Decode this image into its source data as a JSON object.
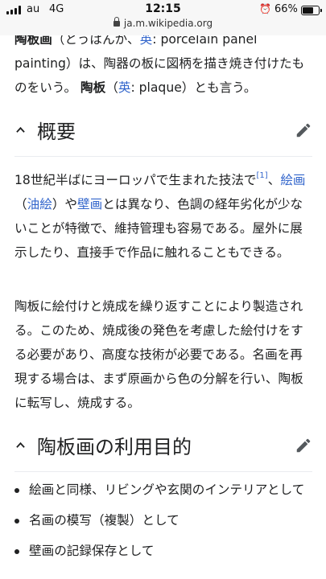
{
  "status_bar": {
    "carrier": "au",
    "network": "4G",
    "time": "12:15",
    "battery": "66%",
    "battery_level": 0.66,
    "url": "ja.m.wikipedia.org"
  },
  "lead": {
    "line1": {
      "term": "陶板画",
      "reading": "（とうばんが、",
      "lang": "英",
      "rest": ": porcelain panel"
    },
    "line2": "painting）は、陶器の板に図柄を描き焼き付けたも",
    "line3": {
      "text": "のをいう。",
      "term2": "陶板",
      "open": "（",
      "lang2": "英",
      "rest": ": plaque）とも言う。"
    }
  },
  "section1": {
    "heading": "概要",
    "para1": {
      "before": "18世紀半ばにヨーロッパで生まれた技法で",
      "ref": "[1]",
      "comma": "、",
      "link_paint": "絵画",
      "open": "（",
      "link_oil": "油絵",
      "close": "）や",
      "link_mural": "壁画",
      "after": "とは異なり、色調の経年劣化が少ないことが特徴で、維持管理も容易である。屋外に展示したり、直接手で作品に触れることもできる。"
    },
    "para2": "陶板に絵付けと焼成を繰り返すことにより製造される。このため、焼成後の発色を考慮した絵付けをする必要があり、高度な技術が必要である。名画を再現する場合は、まず原画から色の分解を行い、陶板に転写し、焼成する。"
  },
  "section2": {
    "heading": "陶板画の利用目的",
    "items": [
      "絵画と同様、リビングや玄関のインテリアとして",
      "名画の模写（複製）として",
      "壁画の記録保存として"
    ]
  },
  "colors": {
    "link": "#3366cc",
    "text": "#202122",
    "divider": "#eaecf0",
    "statusbar_bg": "#f7f7f7"
  },
  "icons": {
    "section_toggle": "chevron-up-icon",
    "edit": "pencil-icon",
    "secure": "lock-icon"
  }
}
